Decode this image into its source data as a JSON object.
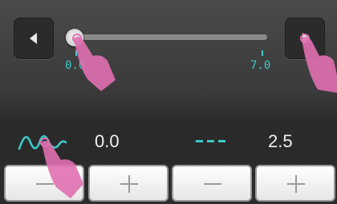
{
  "slider": {
    "min_label": "0.0",
    "max_label": "7.0",
    "value_fraction": 0.0
  },
  "readout": {
    "value_left": "0.0",
    "value_right": "2.5"
  },
  "colors": {
    "accent": "#3fc8c8",
    "hand": "#e070b0",
    "panel": "#2c2c2c"
  },
  "icons": {
    "left_arrow": "left-triangle-icon",
    "right_arrow": "right-triangle-icon",
    "waveform": "waveform-icon",
    "dashed_line": "dashed-line-icon",
    "minus": "minus-icon",
    "plus": "plus-icon",
    "touch_hand": "touch-hand-icon"
  }
}
